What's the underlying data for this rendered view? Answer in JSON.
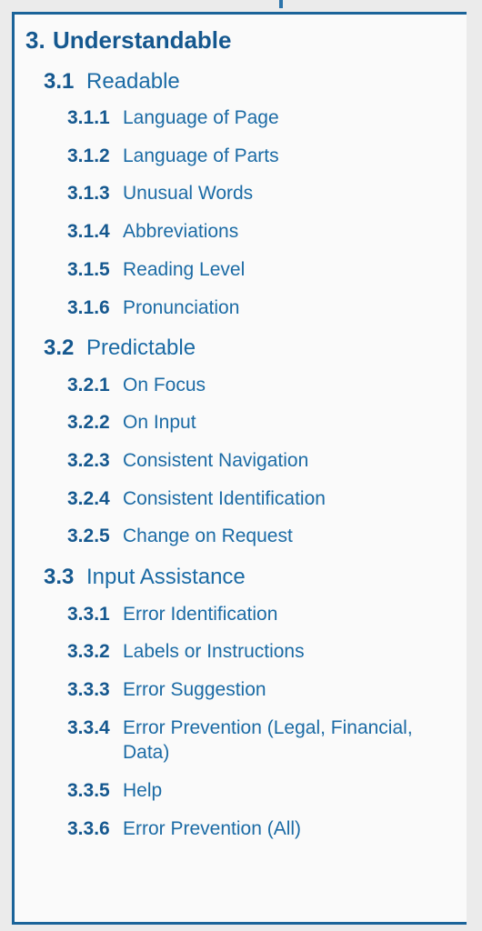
{
  "page": {
    "background_color": "#ebebeb",
    "card_background_color": "#fafafa",
    "border_color": "#1a6399",
    "number_color": "#15588f",
    "label_color": "#1b6ba5"
  },
  "outline": {
    "items": [
      {
        "level": 1,
        "number": "3.",
        "label": "Understandable"
      },
      {
        "level": 2,
        "number": "3.1",
        "label": "Readable"
      },
      {
        "level": 3,
        "number": "3.1.1",
        "label": "Language of Page"
      },
      {
        "level": 3,
        "number": "3.1.2",
        "label": "Language of Parts"
      },
      {
        "level": 3,
        "number": "3.1.3",
        "label": "Unusual Words"
      },
      {
        "level": 3,
        "number": "3.1.4",
        "label": "Abbreviations"
      },
      {
        "level": 3,
        "number": "3.1.5",
        "label": "Reading Level"
      },
      {
        "level": 3,
        "number": "3.1.6",
        "label": "Pronunciation"
      },
      {
        "level": 2,
        "number": "3.2",
        "label": "Predictable"
      },
      {
        "level": 3,
        "number": "3.2.1",
        "label": "On Focus"
      },
      {
        "level": 3,
        "number": "3.2.2",
        "label": "On Input"
      },
      {
        "level": 3,
        "number": "3.2.3",
        "label": "Consistent Navigation"
      },
      {
        "level": 3,
        "number": "3.2.4",
        "label": "Consistent Identification"
      },
      {
        "level": 3,
        "number": "3.2.5",
        "label": "Change on Request"
      },
      {
        "level": 2,
        "number": "3.3",
        "label": "Input Assistance"
      },
      {
        "level": 3,
        "number": "3.3.1",
        "label": "Error Identification"
      },
      {
        "level": 3,
        "number": "3.3.2",
        "label": "Labels or Instructions"
      },
      {
        "level": 3,
        "number": "3.3.3",
        "label": "Error Suggestion"
      },
      {
        "level": 3,
        "number": "3.3.4",
        "label": "Error Prevention (Legal, Financial, Data)"
      },
      {
        "level": 3,
        "number": "3.3.5",
        "label": "Help"
      },
      {
        "level": 3,
        "number": "3.3.6",
        "label": "Error Prevention (All)"
      }
    ]
  }
}
